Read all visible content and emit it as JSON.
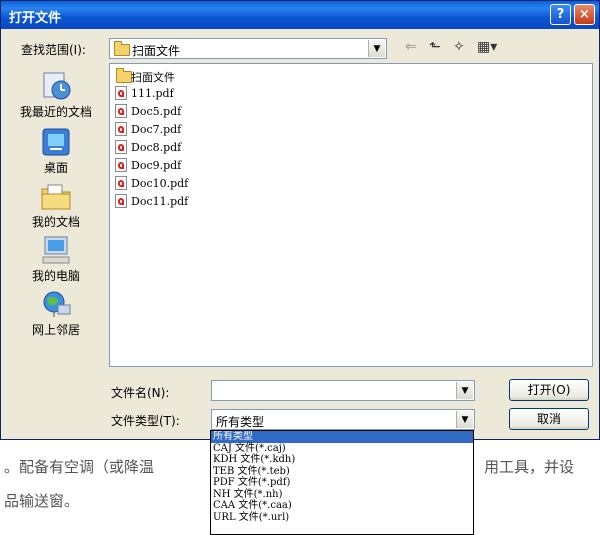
{
  "window": {
    "title": "打开文件",
    "help_label": "?",
    "close_label": "×"
  },
  "lookin": {
    "label": "查找范围(I):",
    "value": "扫面文件"
  },
  "places": [
    {
      "label": "我最近的文档",
      "icon": "recent-documents-icon"
    },
    {
      "label": "桌面",
      "icon": "desktop-icon"
    },
    {
      "label": "我的文档",
      "icon": "my-documents-icon"
    },
    {
      "label": "我的电脑",
      "icon": "my-computer-icon"
    },
    {
      "label": "网上邻居",
      "icon": "network-places-icon"
    }
  ],
  "files": [
    {
      "name": "扫面文件",
      "type": "folder"
    },
    {
      "name": "111.pdf",
      "type": "pdf"
    },
    {
      "name": "Doc5.pdf",
      "type": "pdf"
    },
    {
      "name": "Doc7.pdf",
      "type": "pdf"
    },
    {
      "name": "Doc8.pdf",
      "type": "pdf"
    },
    {
      "name": "Doc9.pdf",
      "type": "pdf"
    },
    {
      "name": "Doc10.pdf",
      "type": "pdf"
    },
    {
      "name": "Doc11.pdf",
      "type": "pdf"
    }
  ],
  "filename": {
    "label": "文件名(N):",
    "value": ""
  },
  "filetype": {
    "label": "文件类型(T):",
    "value": "所有类型",
    "options": [
      "所有类型",
      "CAJ 文件(*.caj)",
      "KDH 文件(*.kdh)",
      "TEB 文件(*.teb)",
      "PDF 文件(*.pdf)",
      "NH 文件(*.nh)",
      "CAA 文件(*.caa)",
      "URL 文件(*.url)"
    ]
  },
  "buttons": {
    "open": "打开(O)",
    "cancel": "取消"
  },
  "background_text": [
    "。配备有空调（或降温",
    "用工具，并设",
    "品输送窗。"
  ]
}
